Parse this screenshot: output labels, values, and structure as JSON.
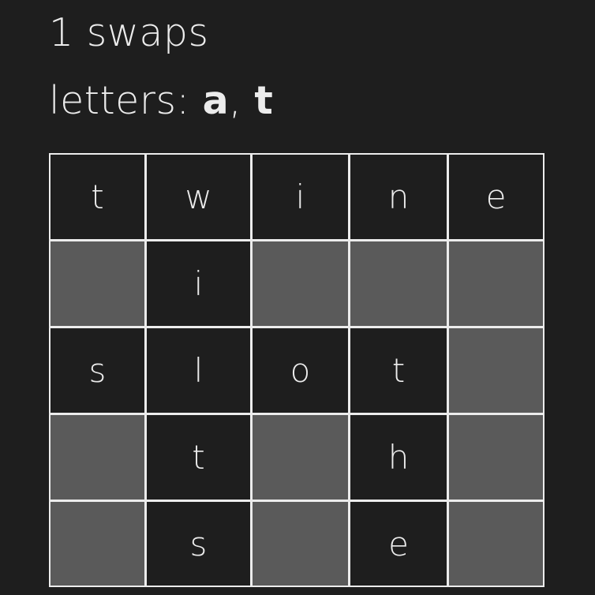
{
  "header": {
    "swaps_text": "1 swaps",
    "letters_prefix": "letters: ",
    "letters": [
      "a",
      "t"
    ],
    "letters_separator": ", "
  },
  "colors": {
    "background": "#1e1e1e",
    "filled_cell": "#1e1e1e",
    "empty_cell": "#5a5a5a",
    "grid_lines": "#ececec",
    "text": "#ececec"
  },
  "board": {
    "rows": [
      [
        "t",
        "w",
        "i",
        "n",
        "e"
      ],
      [
        null,
        "i",
        null,
        null,
        null
      ],
      [
        "s",
        "l",
        "o",
        "t",
        null
      ],
      [
        null,
        "t",
        null,
        "h",
        null
      ],
      [
        null,
        "s",
        null,
        "e",
        null
      ]
    ]
  }
}
